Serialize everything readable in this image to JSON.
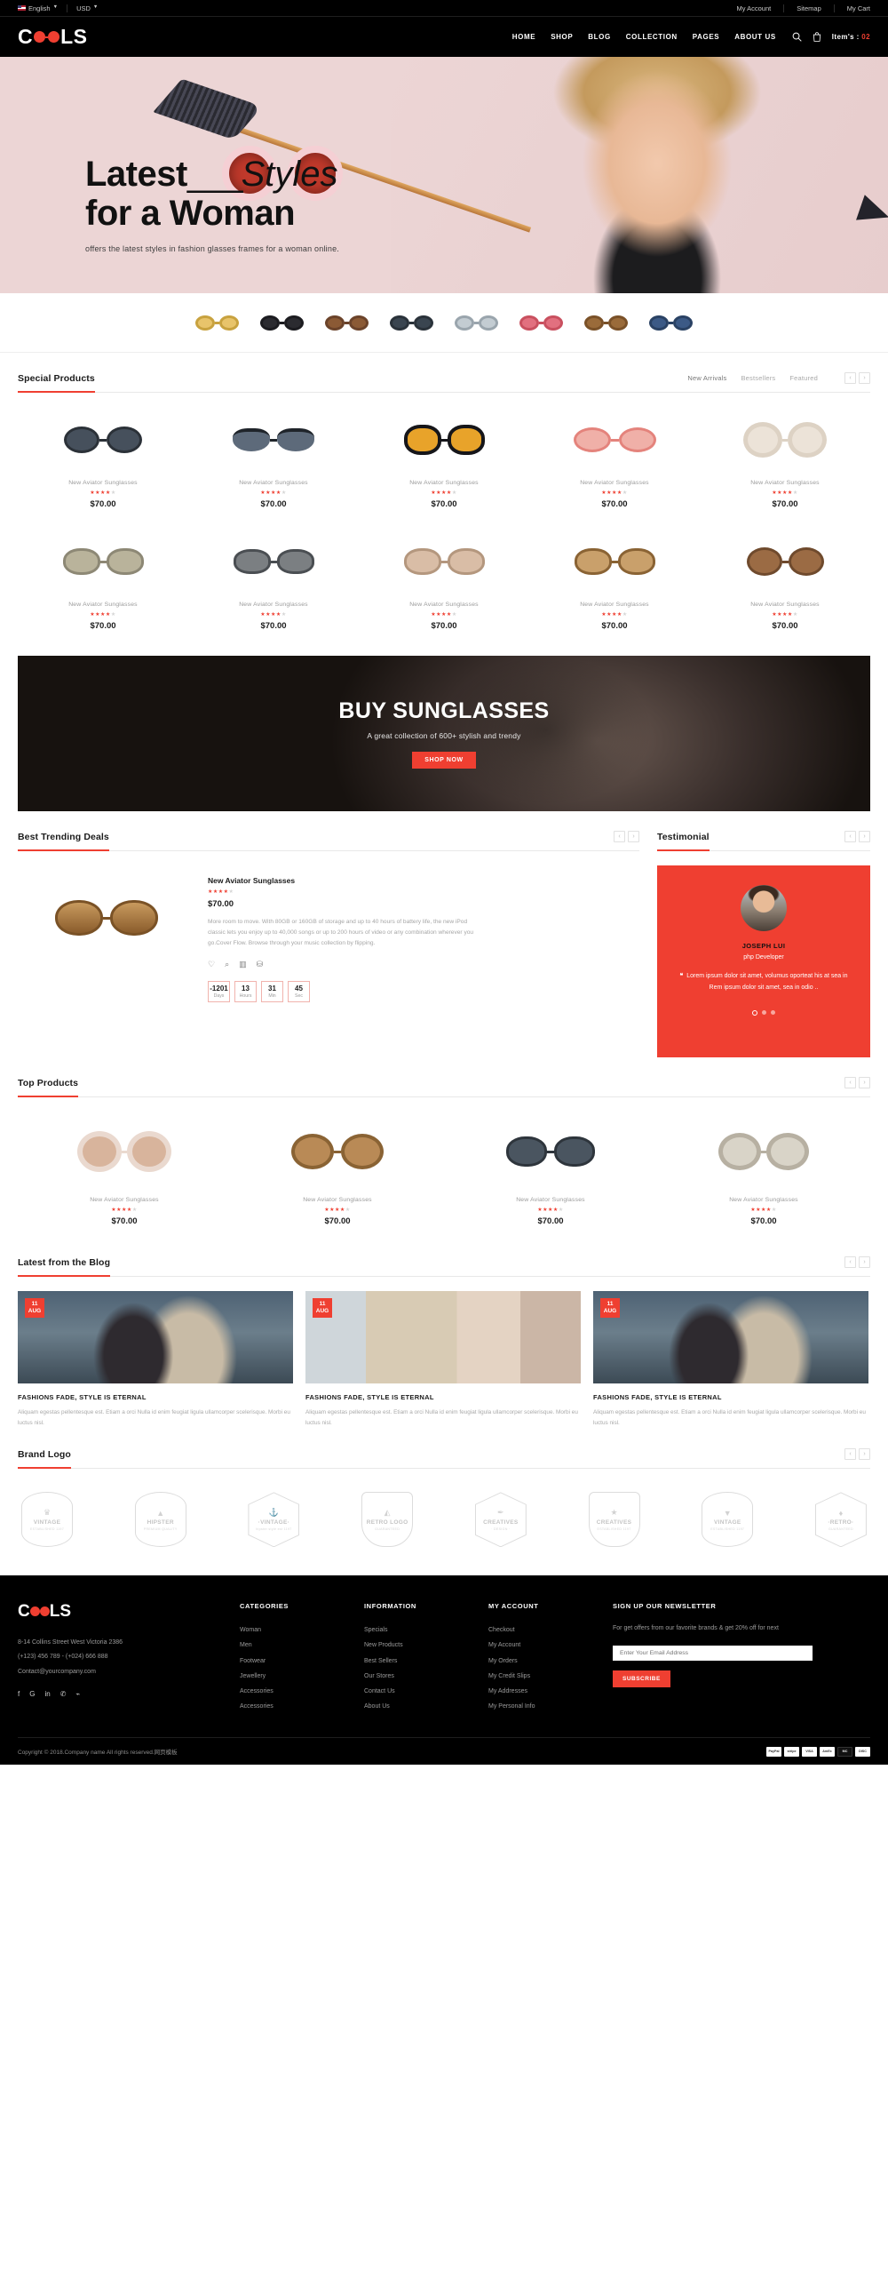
{
  "topbar": {
    "language": "English",
    "currency": "USD",
    "links": [
      "My Account",
      "Sitemap",
      "My Cart"
    ]
  },
  "header": {
    "logo": "COOLS",
    "nav": [
      "HOME",
      "SHOP",
      "BLOG",
      "COLLECTION",
      "PAGES",
      "ABOUT US"
    ],
    "search_icon": "search-icon",
    "cart_icon": "shopping-bag-icon",
    "cart_label": "Item's :",
    "cart_count": "02"
  },
  "hero": {
    "title_bold": "Latest",
    "title_dash": "___",
    "title_italic": "Styles",
    "title_line2": "for a Woman",
    "subtitle": "offers the latest styles in fashion glasses frames for a woman online.",
    "bg_color": "#ecd5d5"
  },
  "thumbstrip": [
    {
      "name": "thumb-glasses-1",
      "lens": "#e8c46b",
      "frame": "#c8a23f"
    },
    {
      "name": "thumb-glasses-2",
      "lens": "#2b2b30",
      "frame": "#1c1c20"
    },
    {
      "name": "thumb-glasses-3",
      "lens": "#8b5a35",
      "frame": "#6b432a"
    },
    {
      "name": "thumb-glasses-4",
      "lens": "#3a4550",
      "frame": "#2a323a"
    },
    {
      "name": "thumb-glasses-5",
      "lens": "#c3ccd2",
      "frame": "#9aa5ad"
    },
    {
      "name": "thumb-glasses-6",
      "lens": "#e2707f",
      "frame": "#c9505f"
    },
    {
      "name": "thumb-glasses-7",
      "lens": "#9a6b3a",
      "frame": "#7a5128"
    },
    {
      "name": "thumb-glasses-8",
      "lens": "#3c5a86",
      "frame": "#2a4264"
    }
  ],
  "special_products": {
    "title": "Special Products",
    "tabs": [
      "New Arrivals",
      "Bestsellers",
      "Featured"
    ],
    "prev": "‹",
    "next": "›",
    "rows": [
      [
        {
          "name": "New Aviator Sunglasses",
          "price": "$70.00",
          "rating": 4,
          "lens": "#46505c",
          "frame": "#2b3138"
        },
        {
          "name": "New Aviator Sunglasses",
          "price": "$70.00",
          "rating": 4,
          "lens": "#5d6a7a",
          "frame": "#1f242a"
        },
        {
          "name": "New Aviator Sunglasses",
          "price": "$70.00",
          "rating": 4,
          "lens": "#e8a32a",
          "frame": "#16161a"
        },
        {
          "name": "New Aviator Sunglasses",
          "price": "$70.00",
          "rating": 4,
          "lens": "#f0b0a8",
          "frame": "#e4837c"
        },
        {
          "name": "New Aviator Sunglasses",
          "price": "$70.00",
          "rating": 4,
          "lens": "#ece3d8",
          "frame": "#ddd2c4"
        }
      ],
      [
        {
          "name": "New Aviator Sunglasses",
          "price": "$70.00",
          "rating": 4,
          "lens": "#b9b39b",
          "frame": "#8d8875"
        },
        {
          "name": "New Aviator Sunglasses",
          "price": "$70.00",
          "rating": 4,
          "lens": "#7b7f82",
          "frame": "#4a4e52"
        },
        {
          "name": "New Aviator Sunglasses",
          "price": "$70.00",
          "rating": 4,
          "lens": "#d9bda6",
          "frame": "#b4977e"
        },
        {
          "name": "New Aviator Sunglasses",
          "price": "$70.00",
          "rating": 4,
          "lens": "#c9a06b",
          "frame": "#9b7murky"
        },
        {
          "name": "New Aviator Sunglasses",
          "price": "$70.00",
          "rating": 4,
          "lens": "#9b6b44",
          "frame": "#6f4a2d"
        }
      ]
    ]
  },
  "banner": {
    "title": "BUY SUNGLASSES",
    "subtitle": "A great collection of 600+ stylish and trendy",
    "button": "SHOP NOW"
  },
  "deals": {
    "title": "Best Trending Deals",
    "prev": "‹",
    "next": "›",
    "product": {
      "name": "New Aviator Sunglasses",
      "rating": 4,
      "price": "$70.00",
      "description": "More room to move. With 80GB or 160GB of storage and up to 40 hours of battery life, the new iPod classic lets you enjoy up to 40,000 songs or up to 200 hours of video or any combination wherever you go.Cover Flow. Browse through your music collection by flipping.",
      "icons": [
        "heart-icon",
        "search-icon",
        "compare-icon",
        "cart-icon"
      ]
    },
    "timer": [
      {
        "value": "-1201",
        "label": "Days"
      },
      {
        "value": "13",
        "label": "Hours"
      },
      {
        "value": "31",
        "label": "Min"
      },
      {
        "value": "45",
        "label": "Sec"
      }
    ]
  },
  "testimonial": {
    "title": "Testimonial",
    "prev": "‹",
    "next": "›",
    "name": "JOSEPH LUI",
    "role": "php Developer",
    "quote_mark": "❝",
    "text": "Lorem ipsum dolor sit amet, volumus oporteat his at sea in Rem ipsum dolor sit amet, sea in odio ..",
    "dots": 3,
    "active_dot": 0,
    "bg_color": "#ef3f31"
  },
  "top_products": {
    "title": "Top Products",
    "prev": "‹",
    "next": "›",
    "items": [
      {
        "name": "New Aviator Sunglasses",
        "price": "$70.00",
        "rating": 4,
        "lens": "#d8b49c",
        "frame": "#ead9cf"
      },
      {
        "name": "New Aviator Sunglasses",
        "price": "$70.00",
        "rating": 4,
        "lens": "#b98a56",
        "frame": "#8a6334"
      },
      {
        "name": "New Aviator Sunglasses",
        "price": "$70.00",
        "rating": 4,
        "lens": "#4a5560",
        "frame": "#2e353c"
      },
      {
        "name": "New Aviator Sunglasses",
        "price": "$70.00",
        "rating": 4,
        "lens": "#d9d4c8",
        "frame": "#b7b0a2"
      }
    ]
  },
  "blog": {
    "title": "Latest from the Blog",
    "prev": "‹",
    "next": "›",
    "posts": [
      {
        "day": "11",
        "month": "AUG",
        "title": "FASHIONS FADE, STYLE IS ETERNAL",
        "excerpt": "Aliquam egestas pellentesque est. Etiam a orci Nulla id enim feugiat ligula ullamcorper scelerisque. Morbi eu luctus nisl."
      },
      {
        "day": "11",
        "month": "AUG",
        "title": "FASHIONS FADE, STYLE IS ETERNAL",
        "excerpt": "Aliquam egestas pellentesque est. Etiam a orci Nulla id enim feugiat ligula ullamcorper scelerisque. Morbi eu luctus nisl."
      },
      {
        "day": "11",
        "month": "AUG",
        "title": "FASHIONS FADE, STYLE IS ETERNAL",
        "excerpt": "Aliquam egestas pellentesque est. Etiam a orci Nulla id enim feugiat ligula ullamcorper scelerisque. Morbi eu luctus nisl."
      }
    ]
  },
  "brands": {
    "title": "Brand Logo",
    "prev": "‹",
    "next": "›",
    "items": [
      {
        "name": "VINTAGE",
        "sub": "ESTABLISHED 1197",
        "symbol": "♛",
        "shape": "oval"
      },
      {
        "name": "HIPSTER",
        "sub": "PREMIUM QUALITY",
        "symbol": "▲",
        "shape": "oval"
      },
      {
        "name": "·VINTAGE·",
        "sub": "hipster style est 1197",
        "symbol": "⚓",
        "shape": "hexa"
      },
      {
        "name": "RETRO LOGO",
        "sub": "GUARANTEED",
        "symbol": "◭",
        "shape": "shield"
      },
      {
        "name": "CREATIVES",
        "sub": "· DESIGN ·",
        "symbol": "✒",
        "shape": "hexa"
      },
      {
        "name": "CREATIVES",
        "sub": "ESTABLISHED 1197",
        "symbol": "★",
        "shape": "shield"
      },
      {
        "name": "VINTAGE",
        "sub": "ESTABLISHED 1197",
        "symbol": "▼",
        "shape": "oval"
      },
      {
        "name": "·RETRO·",
        "sub": "GUARANTEED",
        "symbol": "♦",
        "shape": "hexa"
      }
    ]
  },
  "footer": {
    "logo": "COOLS",
    "address": "8-14 Collins Street West Victoria 2386",
    "phone": "(+123) 456 789 - (+024) 666 888",
    "email": "Contact@yourcompany.com",
    "social": [
      "facebook-icon",
      "google-icon",
      "linkedin-icon",
      "twitter-icon",
      "rss-icon"
    ],
    "social_glyphs": [
      "f",
      "G",
      "in",
      "✉",
      "⌘"
    ],
    "columns": [
      {
        "heading": "CATEGORIES",
        "links": [
          "Woman",
          "Men",
          "Footwear",
          "Jewellery",
          "Accessories",
          "Accessories"
        ]
      },
      {
        "heading": "INFORMATION",
        "links": [
          "Specials",
          "New Products",
          "Best Sellers",
          "Our Stores",
          "Contact Us",
          "About Us"
        ]
      },
      {
        "heading": "MY ACCOUNT",
        "links": [
          "Checkout",
          "My Account",
          "My Orders",
          "My Credit Slips",
          "My Addresses",
          "My Personal Info"
        ]
      }
    ],
    "newsletter": {
      "heading": "SIGN UP OUR NEWSLETTER",
      "text": "For get offers from our favorite brands & get 20% off for next",
      "placeholder": "Enter Your Email Address",
      "button": "SUBSCRIBE"
    },
    "copyright": "Copyright © 2018.Company name All rights reserved.网页模板",
    "payments": [
      "PayPal",
      "stripe",
      "VISA",
      "AmEx",
      "MC",
      "DISC"
    ]
  }
}
